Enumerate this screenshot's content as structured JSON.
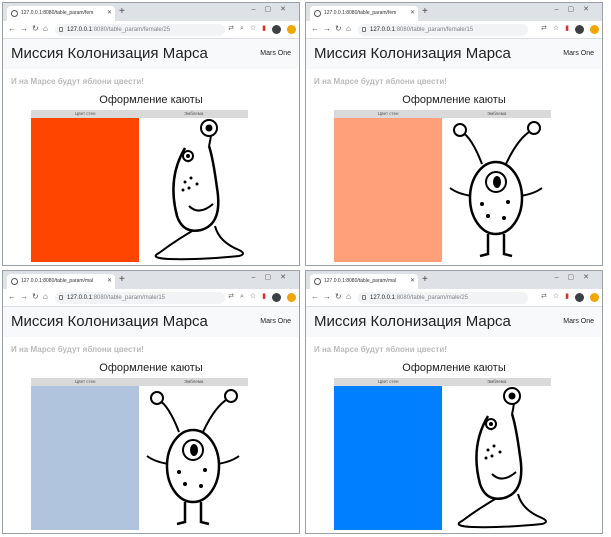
{
  "windows": [
    {
      "tab_title": "127.0.0.1:8080/table_param/fem",
      "url_host": "127.0.0.1",
      "url_path": ":8080/table_param/female/25",
      "site_title": "Миссия Колонизация Марса",
      "user": "Mars One",
      "motto": "И на Марсе будут яблони цвести!",
      "section_title": "Оформление каюты",
      "col_wall": "Цвет стен",
      "col_emblem": "Эмблема",
      "wall_color": "#ff4500",
      "emblem": "alien-adult-icon"
    },
    {
      "tab_title": "127.0.0.1:8080/table_param/fem",
      "url_host": "127.0.0.1",
      "url_path": ":8080/table_param/female/15",
      "site_title": "Миссия Колонизация Марса",
      "user": "Mars One",
      "motto": "И на Марсе будут яблони цвести!",
      "section_title": "Оформление каюты",
      "col_wall": "Цвет стен",
      "col_emblem": "Эмблема",
      "wall_color": "#ffa07a",
      "emblem": "alien-child-icon"
    },
    {
      "tab_title": "127.0.0.1:8080/table_param/mal",
      "url_host": "127.0.0.1",
      "url_path": ":8080/table_param/male/15",
      "site_title": "Миссия Колонизация Марса",
      "user": "Mars One",
      "motto": "И на Марсе будут яблони цвести!",
      "section_title": "Оформление каюты",
      "col_wall": "Цвет стен",
      "col_emblem": "Эмблема",
      "wall_color": "#b0c4de",
      "emblem": "alien-child-icon"
    },
    {
      "tab_title": "127.0.0.1:8080/table_param/mal",
      "url_host": "127.0.0.1",
      "url_path": ":8080/table_param/male/25",
      "site_title": "Миссия Колонизация Марса",
      "user": "Mars One",
      "motto": "И на Марсе будут яблони цвести!",
      "section_title": "Оформление каюты",
      "col_wall": "Цвет стен",
      "col_emblem": "Эмблема",
      "wall_color": "#0080ff",
      "emblem": "alien-adult-icon"
    }
  ]
}
